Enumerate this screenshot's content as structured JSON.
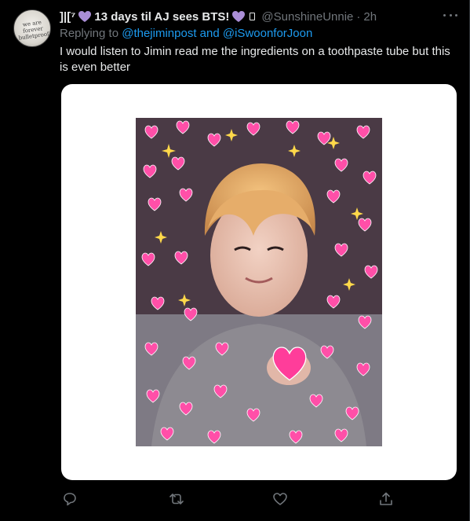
{
  "tweet": {
    "display_name_prefix": "]|[⁷",
    "display_name_main": "13 days til AJ sees BTS!",
    "handle": "@SunshineUnnie",
    "dot": "·",
    "time": "2h",
    "replying_to_label": "Replying to",
    "reply_target_1": "@thejiminpost",
    "reply_and": "and",
    "reply_target_2": "@iSwoonforJoon",
    "text": "I would listen to Jimin read me the ingredients on a toothpaste tube but this is even better",
    "avatar_text": "we are forever bulletproof"
  },
  "icons": {
    "avatar": "profile-avatar",
    "more": "more-options-icon",
    "heart_purple": "purple-heart-emoji",
    "reply": "reply-icon",
    "retweet": "retweet-icon",
    "like": "like-icon",
    "share": "share-icon"
  },
  "colors": {
    "background": "#000000",
    "text_primary": "#e7e9ea",
    "text_secondary": "#71767b",
    "link": "#1d9bf0",
    "purple_heart": "#aa8ed6",
    "pink_heart": "#ff4fa8"
  }
}
